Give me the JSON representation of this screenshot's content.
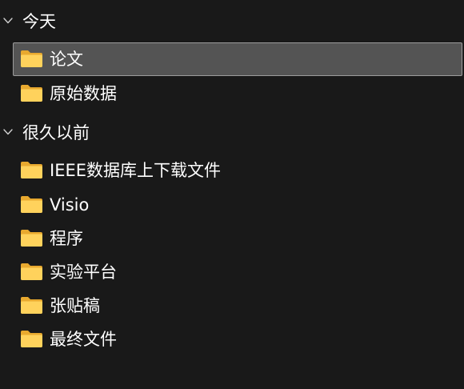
{
  "colors": {
    "background": "#191919",
    "selected_background": "#545454",
    "selected_border": "#9c9c9c",
    "folder_back": "#e8a92f",
    "folder_front": "#ffd25c",
    "text": "#ffffff",
    "chevron": "#cfcfcf"
  },
  "groups": [
    {
      "label": "今天",
      "icon": "chevron-down-icon",
      "items": [
        {
          "label": "论文",
          "icon": "folder-icon",
          "selected": true
        },
        {
          "label": "原始数据",
          "icon": "folder-icon",
          "selected": false
        }
      ]
    },
    {
      "label": "很久以前",
      "icon": "chevron-down-icon",
      "items": [
        {
          "label": "IEEE数据库上下载文件",
          "icon": "folder-icon",
          "selected": false
        },
        {
          "label": "Visio",
          "icon": "folder-icon",
          "selected": false
        },
        {
          "label": "程序",
          "icon": "folder-icon",
          "selected": false
        },
        {
          "label": "实验平台",
          "icon": "folder-icon",
          "selected": false
        },
        {
          "label": "张贴稿",
          "icon": "folder-icon",
          "selected": false
        },
        {
          "label": "最终文件",
          "icon": "folder-icon",
          "selected": false
        }
      ]
    }
  ]
}
